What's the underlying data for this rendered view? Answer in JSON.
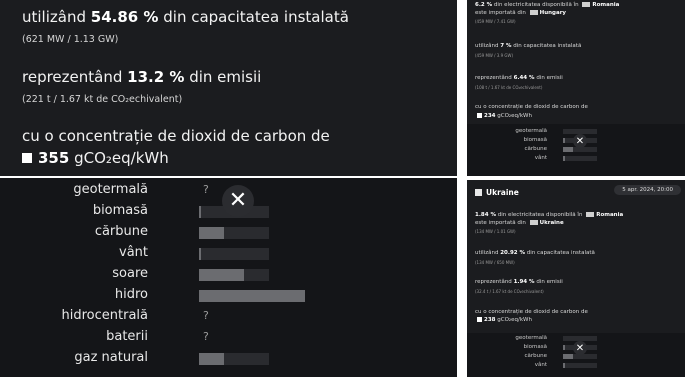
{
  "main": {
    "capacity_prefix": "utilizând",
    "capacity_value": "54.86 %",
    "capacity_suffix": "din capacitatea instalată",
    "capacity_detail": "(621 MW / 1.13 GW)",
    "emissions_prefix": "reprezentând",
    "emissions_value": "13.2 %",
    "emissions_suffix": "din emisii",
    "emissions_detail": "(221 t / 1.67 kt de CO₂echivalent)",
    "intensity_label": "cu o concentrație de dioxid de carbon de",
    "intensity_value": "355",
    "intensity_unit": "gCO₂eq/kWh",
    "close_symbol": "✕",
    "unknown_symbol": "?"
  },
  "sources": [
    {
      "label": "geotermală",
      "unknown": true
    },
    {
      "label": "biomasă",
      "value": 0.01
    },
    {
      "label": "cărbune",
      "value": 0.11
    },
    {
      "label": "vânt",
      "value": 0.01
    },
    {
      "label": "soare",
      "value": 0.2
    },
    {
      "label": "hidro",
      "value": 0.47
    },
    {
      "label": "hidrocentrală",
      "unknown": true
    },
    {
      "label": "baterii",
      "unknown": true
    },
    {
      "label": "gaz natural",
      "value": 0.11
    }
  ],
  "right_top": {
    "line1_value": "6.2 %",
    "line1_text": "din electricitatea disponibilă în",
    "line1_country": "Romania",
    "line1b": "este importată din",
    "line1b_country": "Hungary",
    "line1_detail": "(459 MW / 7.41 GW)",
    "capacity_prefix": "utilizând",
    "capacity_value": "7 %",
    "capacity_suffix": "din capacitatea instalată",
    "capacity_detail": "(459 MW / 3.9 GW)",
    "emissions_prefix": "reprezentând",
    "emissions_value": "6.44 %",
    "emissions_suffix": "din emisii",
    "emissions_detail": "(108 t / 1.67 kt de CO₂echivalent)",
    "intensity_label": "cu o concentrație de dioxid de carbon de",
    "intensity_value": "234",
    "intensity_unit": "gCO₂eq/kWh",
    "sources": [
      "geotermală",
      "biomasă",
      "cărbune",
      "vânt"
    ]
  },
  "right_bottom": {
    "country": "Ukraine",
    "date": "5 apr. 2024, 20:00",
    "line1_value": "1.84 %",
    "line1_text": "din electricitatea disponibilă în",
    "line1_country": "Romania",
    "line1b": "este importată din",
    "line1b_country": "Ukraine",
    "line1_detail": "(134 MW / 1.01 GW)",
    "capacity_prefix": "utilizând",
    "capacity_value": "20.92 %",
    "capacity_suffix": "din capacitatea instalată",
    "capacity_detail": "(134 MW / 650 MW)",
    "emissions_prefix": "reprezentând",
    "emissions_value": "1.94 %",
    "emissions_suffix": "din emisii",
    "emissions_detail": "(32.4 t / 1.67 kt de CO₂echivalent)",
    "intensity_label": "cu o concentrație de dioxid de carbon de",
    "intensity_value": "238",
    "intensity_unit": "gCO₂eq/kWh",
    "sources": [
      "geotermală",
      "biomasă",
      "cărbune",
      "vânt"
    ]
  }
}
